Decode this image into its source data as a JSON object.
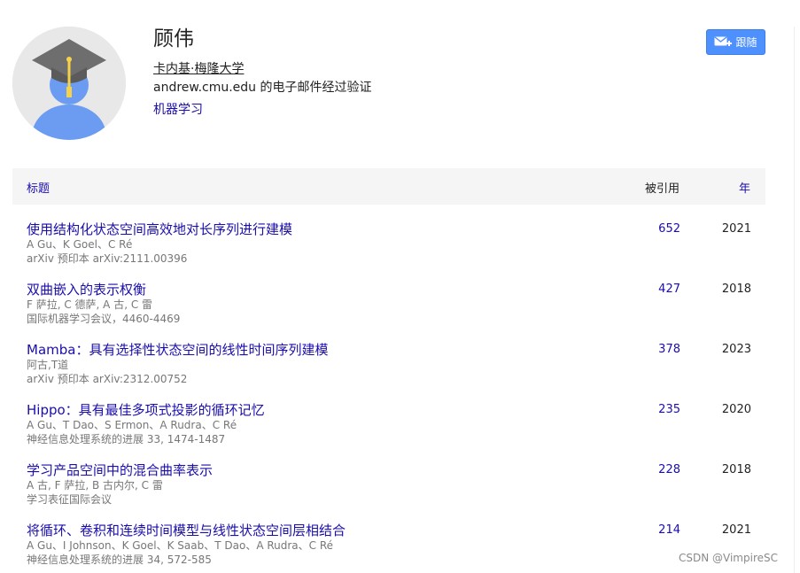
{
  "profile": {
    "name": "顾伟",
    "affiliation": "卡内基·梅隆大学",
    "email_verified": "andrew.cmu.edu 的电子邮件经过验证",
    "interest": "机器学习",
    "follow_label": "跟随"
  },
  "table": {
    "headers": {
      "title": "标题",
      "cited_by": "被引用",
      "year": "年"
    },
    "rows": [
      {
        "title": "使用结构化状态空间高效地对长序列进行建模",
        "authors": "A Gu、K Goel、C Ré",
        "venue": "arXiv 预印本 arXiv:2111.00396",
        "cited": "652",
        "year": "2021"
      },
      {
        "title": "双曲嵌入的表示权衡",
        "authors": "F 萨拉, C 德萨, A 古, C 雷",
        "venue": "国际机器学习会议，4460-4469",
        "cited": "427",
        "year": "2018"
      },
      {
        "title": "Mamba：具有选择性状态空间的线性时间序列建模",
        "authors": "阿古,T道",
        "venue": "arXiv 预印本 arXiv:2312.00752",
        "cited": "378",
        "year": "2023"
      },
      {
        "title": "Hippo：具有最佳多项式投影的循环记忆",
        "authors": "A Gu、T Dao、S Ermon、A Rudra、C Ré",
        "venue": "神经信息处理系统的进展 33, 1474-1487",
        "cited": "235",
        "year": "2020"
      },
      {
        "title": "学习产品空间中的混合曲率表示",
        "authors": "A 古, F 萨拉, B 古内尔, C 雷",
        "venue": "学习表征国际会议",
        "cited": "228",
        "year": "2018"
      },
      {
        "title": "将循环、卷积和连续时间模型与线性状态空间层相结合",
        "authors": "A Gu、I Johnson、K Goel、K Saab、T Dao、A Rudra、C Ré",
        "venue": "神经信息处理系统的进展 34, 572-585",
        "cited": "214",
        "year": "2021"
      }
    ]
  },
  "watermark": "CSDN @VimpireSC",
  "icons": {
    "avatar": "graduate-avatar-icon",
    "follow": "envelope-plus-icon"
  },
  "colors": {
    "link": "#1a0dab",
    "button": "#4d90fe",
    "avatar_body": "#6495ed",
    "header_bg": "#f5f5f5"
  }
}
